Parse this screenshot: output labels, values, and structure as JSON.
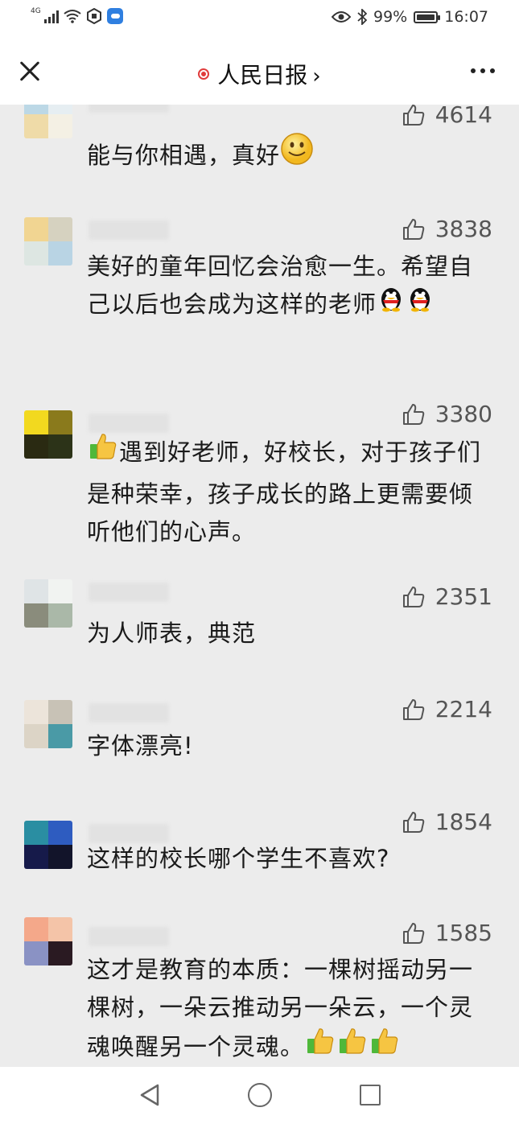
{
  "status_bar": {
    "network": "4G",
    "battery": "99%",
    "battery_level": 0.99,
    "time": "16:07"
  },
  "nav": {
    "title": "人民日报",
    "chevron": "›"
  },
  "comments": [
    {
      "likes": "4614",
      "text": "能与你相遇，真好"
    },
    {
      "likes": "3838",
      "text": "美好的童年回忆会治愈一生。希望自己以后也会成为这样的老师"
    },
    {
      "likes": "3380",
      "text": "遇到好老师，好校长，对于孩子们是种荣幸，孩子成长的路上更需要倾听他们的心声。"
    },
    {
      "likes": "2351",
      "text": "为人师表，典范"
    },
    {
      "likes": "2214",
      "text": "字体漂亮!"
    },
    {
      "likes": "1854",
      "text": "这样的校长哪个学生不喜欢?"
    },
    {
      "likes": "1585",
      "text": "这才是教育的本质：一棵树摇动另一棵树，一朵云推动另一朵云，一个灵魂唤醒另一个灵魂。"
    }
  ],
  "icons": {
    "close": "close-icon",
    "more": "more-icon",
    "like": "thumb-up-icon",
    "smile": "smile-emoji-icon",
    "penguin": "qq-penguin-emoji-icon",
    "thumbs": "thumbs-up-emoji-icon",
    "back": "back-triangle-icon",
    "home": "home-circle-icon",
    "recent": "recent-square-icon"
  },
  "colors": {
    "accent_red": "#e03c3c",
    "background": "#ececec",
    "bar": "#ffffff",
    "like_text": "#555555"
  }
}
